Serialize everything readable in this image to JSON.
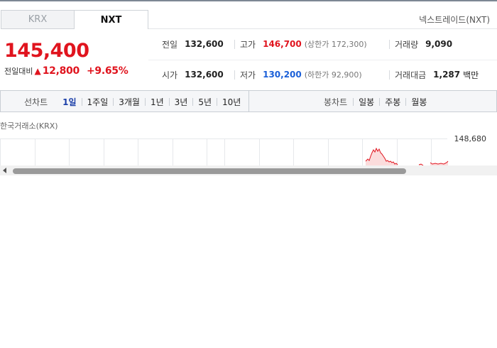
{
  "tabs": [
    {
      "label": "KRX",
      "active": false
    },
    {
      "label": "NXT",
      "active": true
    }
  ],
  "market_name": "넥스트레이드(NXT)",
  "price": {
    "current": "145,400",
    "change_label": "전일대비",
    "change_icon": "up-triangle-icon",
    "change_symbol": "▲",
    "change_amount": "12,800",
    "change_percent": "+9.65%"
  },
  "stats": {
    "prev_close_label": "전일",
    "prev_close": "132,600",
    "high_label": "고가",
    "high": "146,700",
    "upper_limit_label": "상한가",
    "upper_limit": "172,300",
    "volume_label": "거래량",
    "volume": "9,090",
    "open_label": "시가",
    "open": "132,600",
    "low_label": "저가",
    "low": "130,200",
    "lower_limit_label": "하한가",
    "lower_limit": "92,900",
    "amount_label": "거래대금",
    "amount": "1,287",
    "amount_unit": "백만"
  },
  "chart_toolbar": {
    "line_chart_label": "선차트",
    "periods": [
      "1일",
      "1주일",
      "3개월",
      "1년",
      "3년",
      "5년",
      "10년"
    ],
    "active_period": "1일",
    "candle_chart_label": "봉차트",
    "candle_periods": [
      "일봉",
      "주봉",
      "월봉"
    ]
  },
  "chart": {
    "source_label": "한국거래소(KRX)",
    "y_axis_top": "148,680"
  },
  "colors": {
    "up": "#e0141e",
    "down": "#1a5fd8",
    "active_period": "#1a3ea8"
  }
}
